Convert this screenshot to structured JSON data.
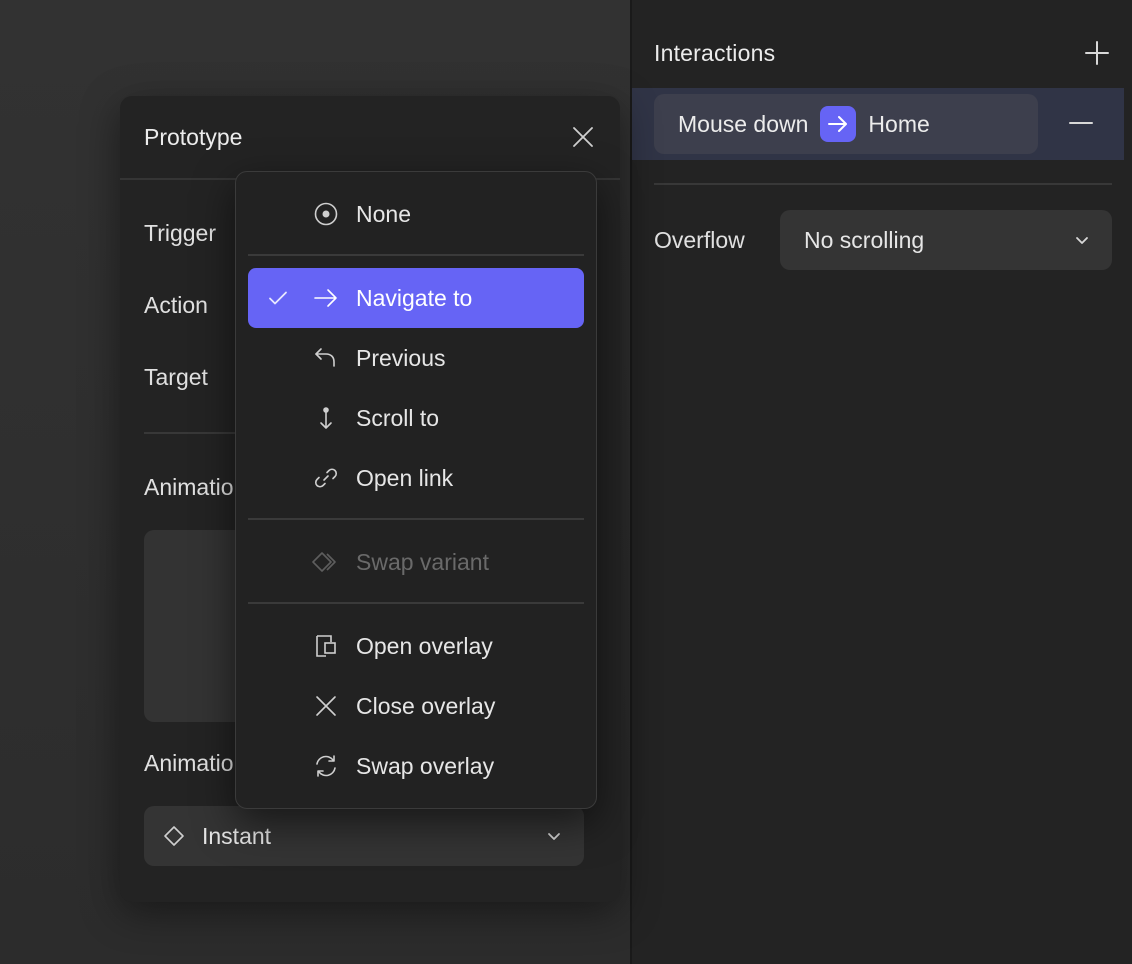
{
  "right_panel": {
    "title": "Interactions",
    "interaction": {
      "trigger": "Mouse down",
      "target": "Home"
    },
    "overflow": {
      "label": "Overflow",
      "value": "No scrolling"
    }
  },
  "prototype_panel": {
    "title": "Prototype",
    "labels": {
      "trigger": "Trigger",
      "action": "Action",
      "target": "Target",
      "animation_1": "Animatio",
      "animation_2": "Animatio"
    },
    "easing": "Instant"
  },
  "action_menu": {
    "none": "None",
    "navigate_to": "Navigate to",
    "previous": "Previous",
    "scroll_to": "Scroll to",
    "open_link": "Open link",
    "swap_variant": "Swap variant",
    "open_overlay": "Open overlay",
    "close_overlay": "Close overlay",
    "swap_overlay": "Swap overlay",
    "selected": "Navigate to"
  },
  "colors": {
    "accent": "#6664f5",
    "selection_band": "#303446"
  }
}
